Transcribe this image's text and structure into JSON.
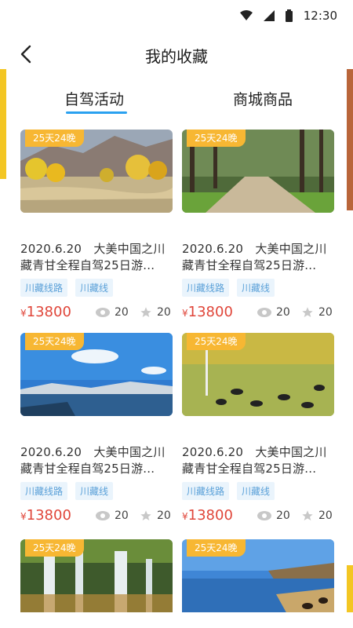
{
  "status": {
    "time": "12:30"
  },
  "header": {
    "title": "我的收藏"
  },
  "tabs": [
    {
      "label": "自驾活动"
    },
    {
      "label": "商城商品"
    }
  ],
  "cards": [
    {
      "badge": "25天24晚",
      "title_line1": "2020.6.20　大美中国之川",
      "title_line2": "藏青甘全程自驾25日游...",
      "tags": [
        "川藏线路",
        "川藏线"
      ],
      "currency": "¥",
      "price": "13800",
      "views": "20",
      "stars": "20"
    },
    {
      "badge": "25天24晚",
      "title_line1": "2020.6.20　大美中国之川",
      "title_line2": "藏青甘全程自驾25日游...",
      "tags": [
        "川藏线路",
        "川藏线"
      ],
      "currency": "¥",
      "price": "13800",
      "views": "20",
      "stars": "20"
    },
    {
      "badge": "25天24晚",
      "title_line1": "2020.6.20　大美中国之川",
      "title_line2": "藏青甘全程自驾25日游...",
      "tags": [
        "川藏线路",
        "川藏线"
      ],
      "currency": "¥",
      "price": "13800",
      "views": "20",
      "stars": "20"
    },
    {
      "badge": "25天24晚",
      "title_line1": "2020.6.20　大美中国之川",
      "title_line2": "藏青甘全程自驾25日游...",
      "tags": [
        "川藏线路",
        "川藏线"
      ],
      "currency": "¥",
      "price": "13800",
      "views": "20",
      "stars": "20"
    },
    {
      "badge": "25天24晚"
    },
    {
      "badge": "25天24晚"
    }
  ],
  "colors": {
    "accent": "#2aa1f0",
    "badge": "#f7b733",
    "price": "#e0463a",
    "tag_text": "#5aa0d8"
  }
}
